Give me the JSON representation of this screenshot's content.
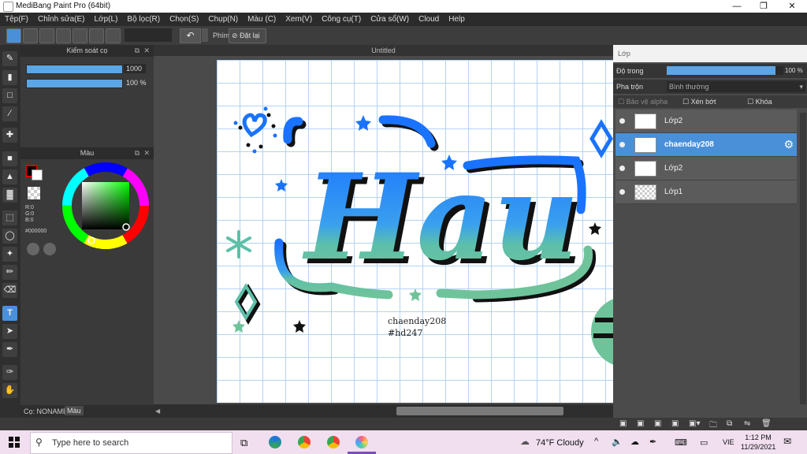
{
  "window": {
    "title": "MediBang Paint Pro (64bit)",
    "min_icon": "minimize-icon",
    "max_icon": "maximize-icon",
    "close_icon": "close-icon"
  },
  "menu": [
    "Tệp(F)",
    "Chỉnh sửa(E)",
    "Lớp(L)",
    "Bộ lọc(R)",
    "Chọn(S)",
    "Chụp(N)",
    "Màu (C)",
    "Xem(V)",
    "Công cụ(T)",
    "Cửa sổ(W)",
    "Cloud",
    "Help"
  ],
  "toolbar": {
    "undo_icon": "undo-icon",
    "shortcut_label": "Phím",
    "reset_label": "Đặt lại"
  },
  "brush_panel": {
    "title": "Kiểm soát cọ",
    "size_value": "1000",
    "opacity_value": "100 %"
  },
  "color_panel": {
    "title": "Màu",
    "r": "R:0",
    "g": "G:0",
    "b": "B:0",
    "hex": "#000000"
  },
  "bottom_left": {
    "brush_name": "Cọ: NONAME",
    "tab": "Màu"
  },
  "canvas": {
    "tab_title": "Untitled",
    "text_line1": "chaenday208",
    "text_line2": "#hd247"
  },
  "layer_panel": {
    "title": "Lớp",
    "opacity_label": "Độ trong",
    "opacity_value": "100 %",
    "opacity_fill": 0.93,
    "blend_label": "Pha trộn",
    "blend_value": "Bình thường",
    "protect_alpha": "Bảo vệ alpha",
    "clip": "Xén bớt",
    "lock": "Khóa",
    "layers": [
      {
        "name": "Lớp2",
        "selected": false
      },
      {
        "name": "chaenday208",
        "selected": true
      },
      {
        "name": "Lớp2",
        "selected": false
      },
      {
        "name": "Lớp1",
        "selected": false
      }
    ]
  },
  "taskbar": {
    "search_placeholder": "Type here to search",
    "weather": "74°F  Cloudy",
    "lang": "VIE",
    "time": "1:12 PM",
    "date": "11/29/2021"
  }
}
